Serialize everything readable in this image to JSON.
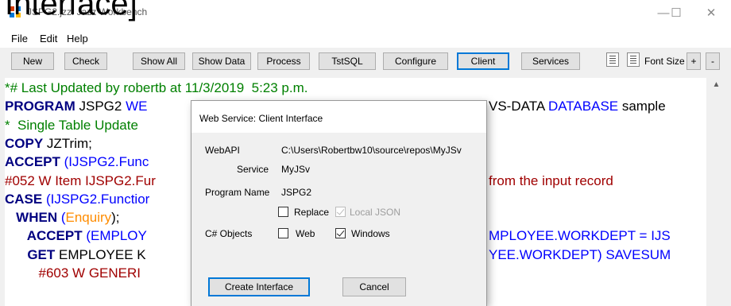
{
  "caption": "Interface]",
  "window": {
    "title": "JSPG2.jzz: Jazz Workbench",
    "minimize": "—",
    "maximize": "☐",
    "close": "✕"
  },
  "menu": [
    "File",
    "Edit",
    "Help"
  ],
  "toolbar": {
    "buttons": [
      "New",
      "Check",
      "Show All",
      "Show Data",
      "Process",
      "TstSQL",
      "Configure",
      "Client",
      "Services"
    ],
    "active_button": "Client",
    "font_size_label": "Font Size",
    "font_plus": "+",
    "font_minus": "-"
  },
  "code": {
    "lines": [
      [
        {
          "t": "*# Last Updated by robertb at 11/3/2019  5:23 p.m.",
          "c": "green"
        }
      ],
      [
        {
          "t": "PROGRAM",
          "c": "navy",
          "b": true
        },
        {
          "t": " JSPG2 ",
          "c": "black"
        },
        {
          "t": "WE",
          "c": "blue"
        }
      ],
      [
        {
          "t": "*  Single Table Update",
          "c": "green"
        }
      ],
      [
        {
          "t": "COPY",
          "c": "navy",
          "b": true
        },
        {
          "t": " JZTrim;",
          "c": "black"
        }
      ],
      [
        {
          "t": "ACCEPT",
          "c": "navy",
          "b": true
        },
        {
          "t": " (IJSPG2.Func",
          "c": "blue"
        }
      ],
      [
        {
          "t": "#052 W Item IJSPG2.Fur",
          "c": "darkred"
        }
      ],
      [
        {
          "t": "CASE",
          "c": "navy",
          "b": true
        },
        {
          "t": " (IJSPG2.Functior",
          "c": "blue"
        }
      ],
      [
        {
          "t": "   WHEN",
          "c": "navy",
          "b": true
        },
        {
          "t": " (",
          "c": "blue"
        },
        {
          "t": "Enquiry",
          "c": "orange"
        },
        {
          "t": ");",
          "c": "black"
        }
      ],
      [
        {
          "t": "      ACCEPT",
          "c": "navy",
          "b": true
        },
        {
          "t": " (EMPLOY",
          "c": "blue"
        }
      ],
      [
        {
          "t": "      GET",
          "c": "navy",
          "b": true
        },
        {
          "t": " EMPLOYEE K",
          "c": "black"
        }
      ],
      [
        {
          "t": "         #603 W GENERI",
          "c": "darkred"
        }
      ]
    ],
    "right_fragments": [
      {
        "row": 1,
        "parts": [
          {
            "t": "VS-DATA ",
            "c": "black"
          },
          {
            "t": "DATABASE",
            "c": "blue"
          },
          {
            "t": " sample",
            "c": "black"
          }
        ]
      },
      {
        "row": 5,
        "parts": [
          {
            "t": "from the input record",
            "c": "darkred"
          }
        ]
      },
      {
        "row": 8,
        "parts": [
          {
            "t": "MPLOYEE.WORKDEPT = IJS",
            "c": "blue"
          }
        ]
      },
      {
        "row": 9,
        "parts": [
          {
            "t": "YEE.WORKDEPT) SAVESUM",
            "c": "blue"
          }
        ]
      }
    ]
  },
  "dialog": {
    "title": "Web Service: Client Interface",
    "webapi_label": "WebAPI",
    "webapi_value": "C:\\Users\\Robertbw10\\source\\repos\\MyJSv",
    "service_label": "Service",
    "service_value": "MyJSv",
    "program_name_label": "Program Name",
    "program_name_value": "JSPG2",
    "replace_label": "Replace",
    "replace_checked": false,
    "local_json_label": "Local JSON",
    "local_json_checked": true,
    "local_json_enabled": false,
    "csharp_label": "C# Objects",
    "web_label": "Web",
    "web_checked": false,
    "windows_label": "Windows",
    "windows_checked": true,
    "create_button": "Create Interface",
    "cancel_button": "Cancel"
  },
  "colors": {
    "green": "#008000",
    "navy": "#000080",
    "blue": "#0000ff",
    "darkred": "#a00000",
    "orange": "#ff8c00",
    "black": "#000000",
    "accent": "#0078d7"
  }
}
